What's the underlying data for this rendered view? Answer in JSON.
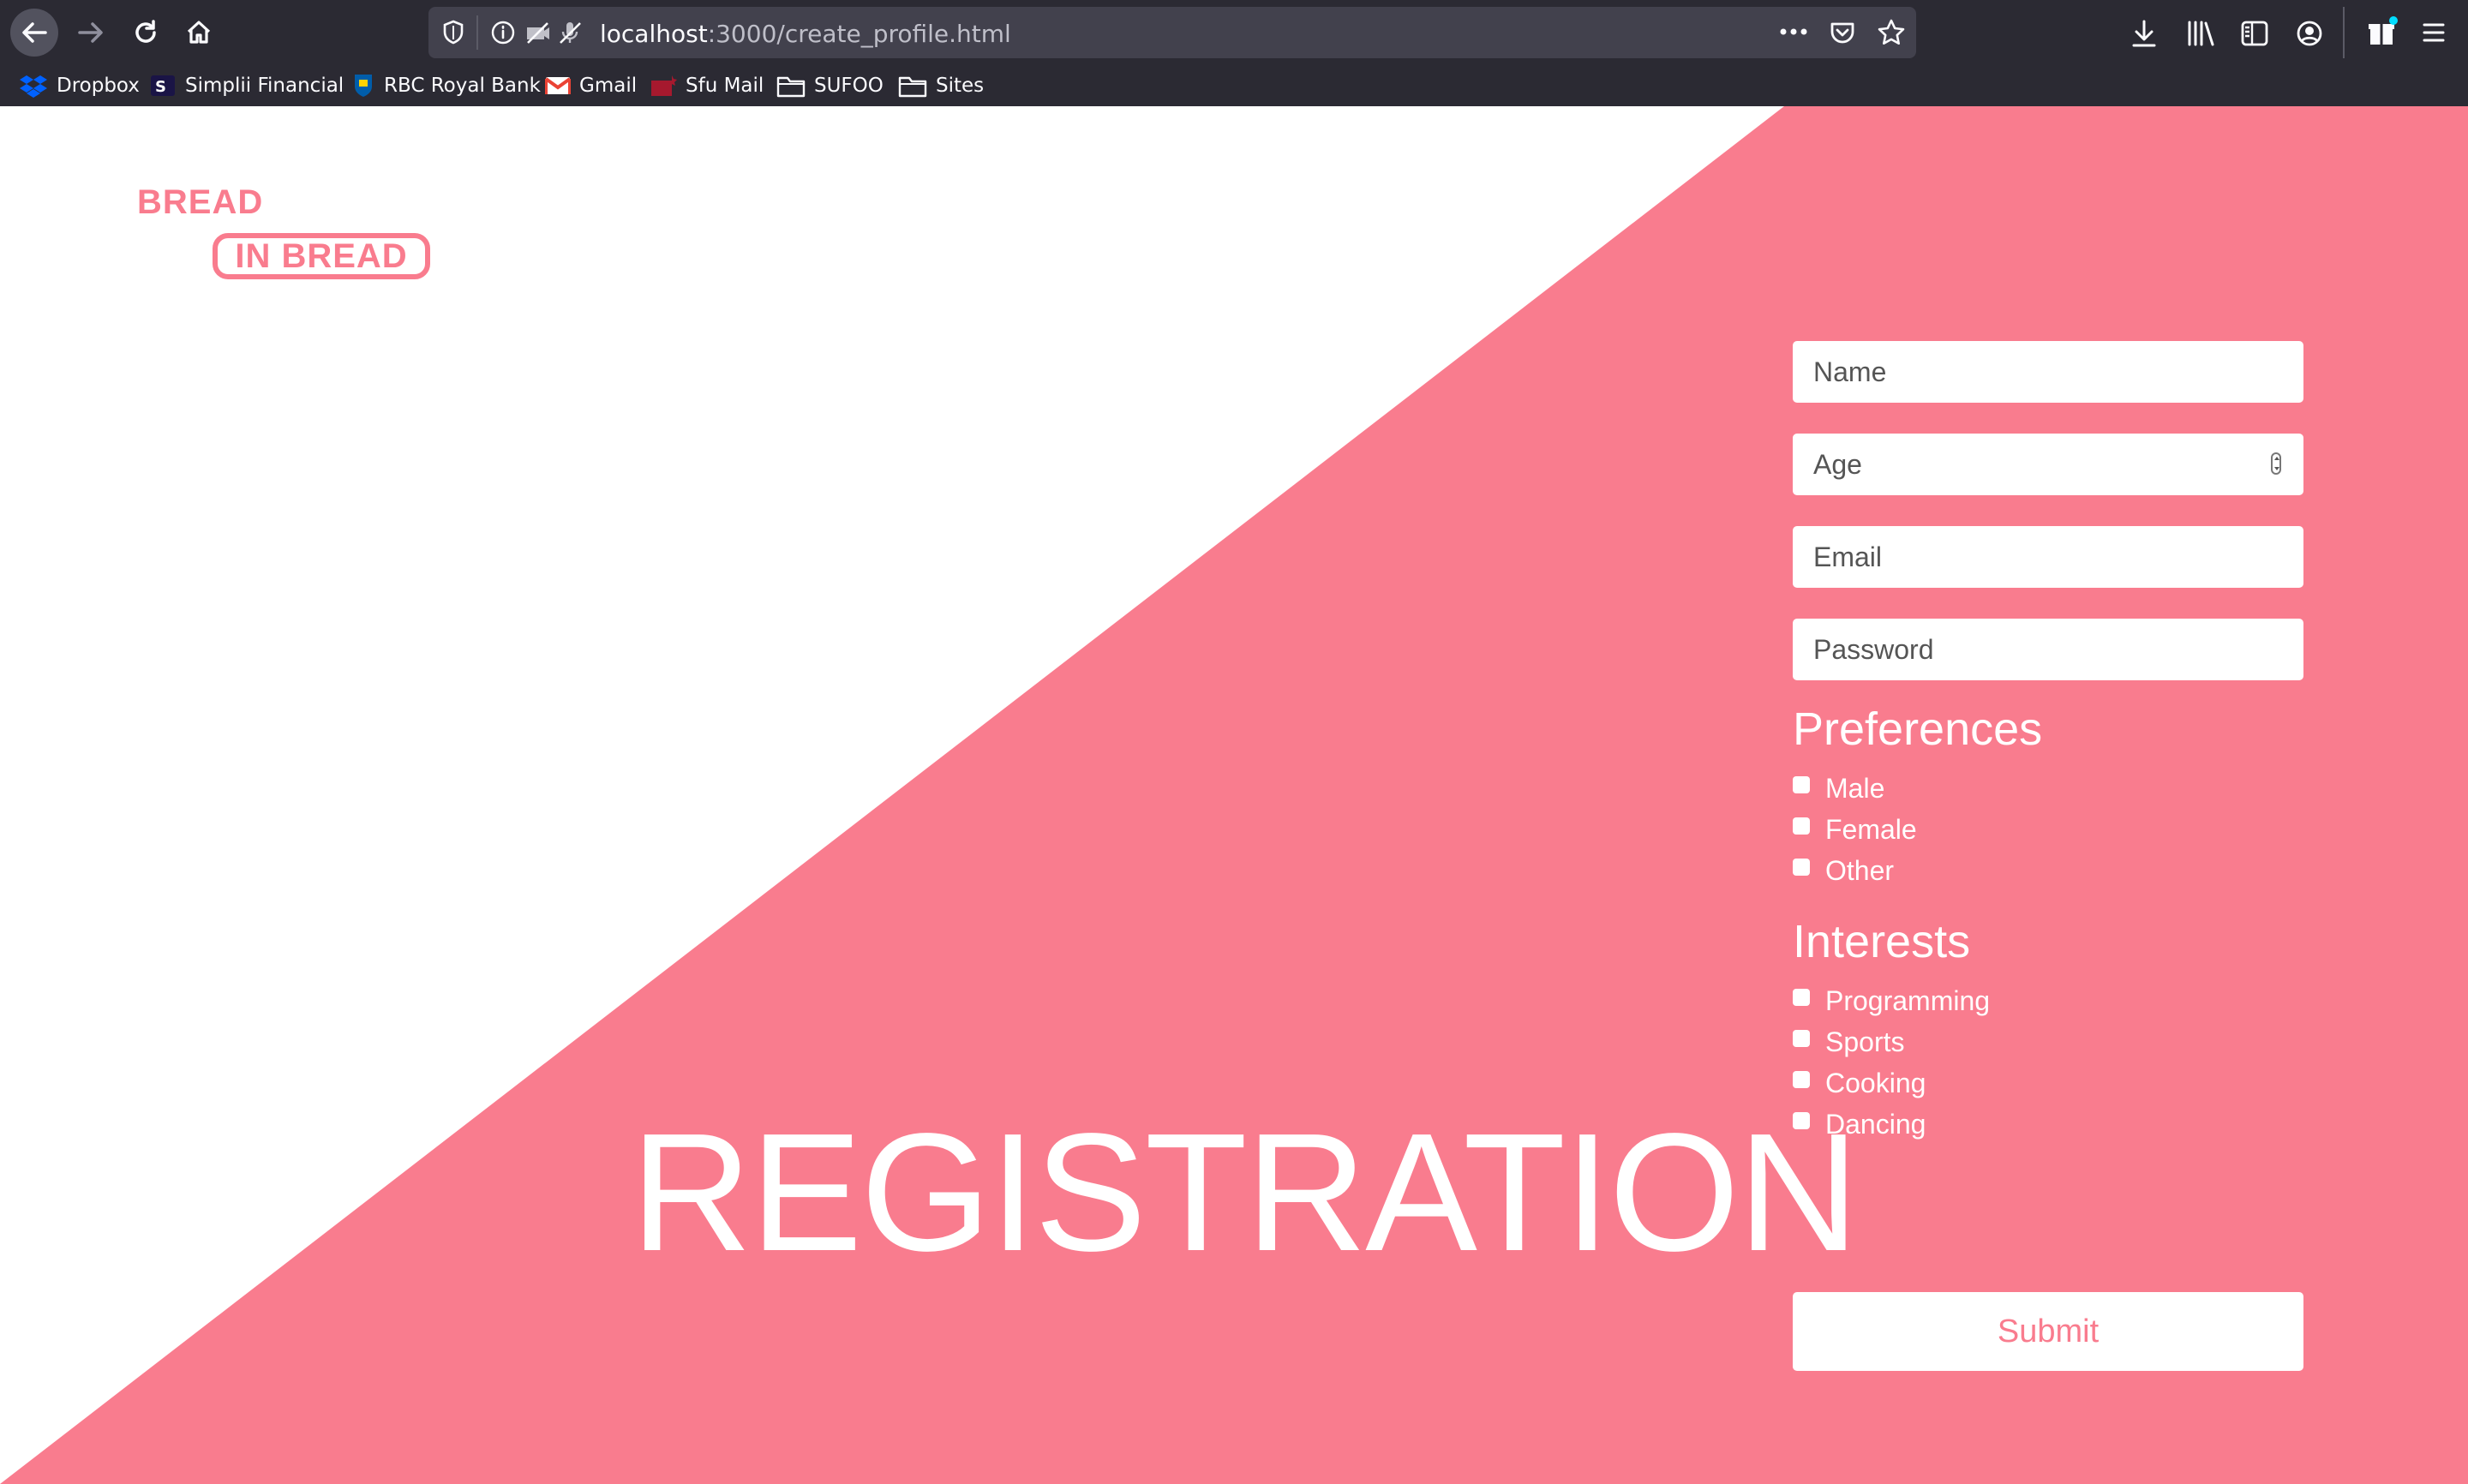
{
  "browser": {
    "url_host": "localhost",
    "url_path": ":3000/create_profile.html",
    "bookmarks": [
      {
        "label": "Dropbox",
        "icon": "dropbox-icon"
      },
      {
        "label": "Simplii Financial",
        "icon": "simplii-icon"
      },
      {
        "label": "RBC Royal Bank",
        "icon": "rbc-icon"
      },
      {
        "label": "Gmail",
        "icon": "gmail-icon"
      },
      {
        "label": "Sfu Mail",
        "icon": "sfu-icon"
      },
      {
        "label": "SUFOO",
        "icon": "folder-icon"
      },
      {
        "label": "Sites",
        "icon": "folder-icon"
      }
    ]
  },
  "logo": {
    "line1": "BREAD",
    "line2": "IN BREAD"
  },
  "page_title": "REGISTRATION",
  "form": {
    "name_placeholder": "Name",
    "age_placeholder": "Age",
    "email_placeholder": "Email",
    "password_placeholder": "Password",
    "preferences_heading": "Preferences",
    "preferences": [
      "Male",
      "Female",
      "Other"
    ],
    "interests_heading": "Interests",
    "interests": [
      "Programming",
      "Sports",
      "Cooking",
      "Dancing"
    ],
    "submit_label": "Submit"
  },
  "colors": {
    "accent": "#f97c8e",
    "chrome": "#2b2a33"
  }
}
